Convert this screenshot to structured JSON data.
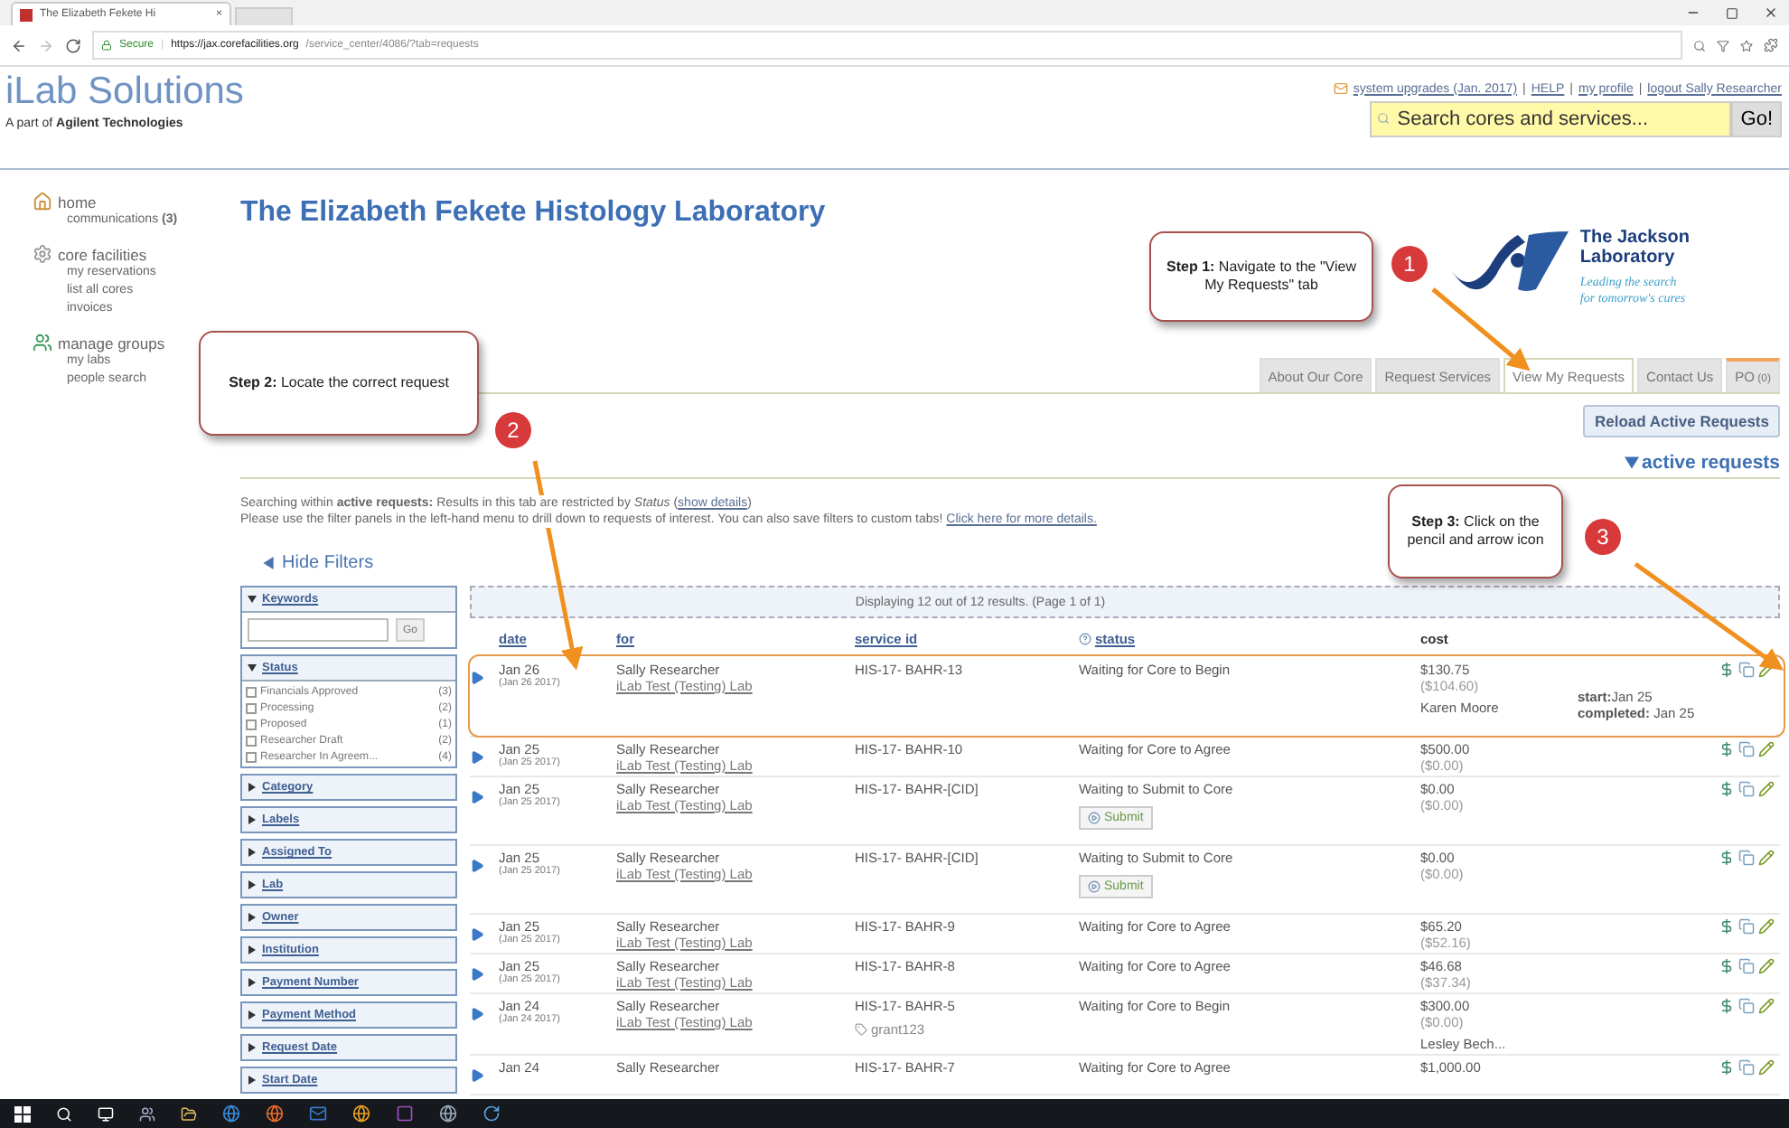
{
  "browser": {
    "tab_title": "The Elizabeth Fekete Hi",
    "tab_close": "×",
    "secure_label": "Secure",
    "url_host": "https://jax.corefacilities.org",
    "url_path": "/service_center/4086/?tab=requests"
  },
  "header": {
    "logo": "iLab Solutions",
    "tagline": "A part of **Agilent Technologies**"
  },
  "top_links": {
    "separator": "|",
    "links": [
      "system upgrades (Jan. 2017)",
      "HELP",
      "my profile",
      "logout Sally Researcher"
    ]
  },
  "search": {
    "placeholder": "Search cores and services...",
    "button": "Go!"
  },
  "nav": [
    {
      "label": "home",
      "kind": "home",
      "children": [
        {
          "label": "communications",
          "count": "(3)"
        }
      ]
    },
    {
      "label": "core facilities",
      "kind": "gear",
      "children": [
        {
          "label": "my reservations"
        },
        {
          "label": "list all cores"
        },
        {
          "label": "invoices"
        }
      ]
    },
    {
      "label": "manage groups",
      "kind": "people",
      "children": [
        {
          "label": "my labs"
        },
        {
          "label": "people search"
        }
      ]
    }
  ],
  "title": "The Elizabeth Fekete Histology Laboratory",
  "partner": {
    "name_lines": [
      "The Jackson",
      "Laboratory"
    ],
    "slogan_lines": [
      "Leading the search",
      "for tomorrow's cures"
    ]
  },
  "tabs": [
    {
      "label": "About Our Core",
      "selected": false
    },
    {
      "label": "Request Services",
      "selected": false
    },
    {
      "label": "View My Requests",
      "selected": true
    },
    {
      "label": "Contact Us",
      "selected": false
    },
    {
      "label": "PO",
      "count": "(0)",
      "selected": false
    }
  ],
  "reload_button": "Reload Active Requests",
  "section": {
    "label": "active requests",
    "expanded": true
  },
  "notice": [
    {
      "text": "Searching within **active requests:** Results in this tab are restricted by *Status* (",
      "link": "show details",
      "after": ")"
    },
    {
      "text": "Please use the filter panels in the left-hand menu to drill down to requests of interest. You can also save filters to custom tabs! ",
      "link": "Click here for more details."
    }
  ],
  "hide_filters": "Hide Filters",
  "filters": [
    {
      "title": "Keywords",
      "kind": "keywords",
      "expanded": true,
      "button": "Go"
    },
    {
      "title": "Status",
      "kind": "options",
      "expanded": true,
      "options": [
        {
          "label": "Financials Approved",
          "count": "(3)",
          "checked": false
        },
        {
          "label": "Processing",
          "count": "(2)",
          "checked": false
        },
        {
          "label": "Proposed",
          "count": "(1)",
          "checked": false
        },
        {
          "label": "Researcher Draft",
          "count": "(2)",
          "checked": false
        },
        {
          "label": "Researcher In Agreem...",
          "count": "(4)",
          "checked": false
        }
      ]
    },
    {
      "title": "Category",
      "expanded": false
    },
    {
      "title": "Labels",
      "expanded": false
    },
    {
      "title": "Assigned To",
      "expanded": false
    },
    {
      "title": "Lab",
      "expanded": false
    },
    {
      "title": "Owner",
      "expanded": false
    },
    {
      "title": "Institution",
      "expanded": false
    },
    {
      "title": "Payment Number",
      "expanded": false
    },
    {
      "title": "Payment Method",
      "expanded": false
    },
    {
      "title": "Request Date",
      "expanded": false
    },
    {
      "title": "Start Date",
      "expanded": false
    }
  ],
  "results": {
    "summary": "Displaying 12 out of 12 results. (Page 1 of 1)",
    "columns": [
      {
        "label": "date",
        "help": false,
        "sortable": true
      },
      {
        "label": "for",
        "help": false,
        "sortable": true
      },
      {
        "label": "service id",
        "help": false,
        "sortable": true
      },
      {
        "label": "status",
        "help": true,
        "sortable": true
      },
      {
        "label": "cost",
        "help": false,
        "sortable": false
      }
    ],
    "rows": [
      {
        "date": "Jan 26",
        "full_date": "(Jan 26 2017)",
        "person": "Sally Researcher",
        "lab": "iLab Test (Testing) Lab",
        "service_id": "HIS-17- BAHR-13",
        "status": "Waiting for Core to Begin",
        "cost": "$130.75",
        "subtotal": "($104.60)",
        "assignee": "Karen Moore",
        "start_label": "start:",
        "start": "Jan 25",
        "completed_label": "completed:",
        "completed": "Jan 25",
        "highlighted": true
      },
      {
        "date": "Jan 25",
        "full_date": "(Jan 25 2017)",
        "person": "Sally Researcher",
        "lab": "iLab Test (Testing) Lab",
        "service_id": "HIS-17- BAHR-10",
        "status": "Waiting for Core to Agree",
        "cost": "$500.00",
        "subtotal": "($0.00)",
        "highlighted": false
      },
      {
        "date": "Jan 25",
        "full_date": "(Jan 25 2017)",
        "person": "Sally Researcher",
        "lab": "iLab Test (Testing) Lab",
        "service_id": "HIS-17- BAHR-[CID]",
        "status": "Waiting to Submit to Core",
        "cost": "$0.00",
        "subtotal": "($0.00)",
        "action": "Submit",
        "highlighted": false
      },
      {
        "date": "Jan 25",
        "full_date": "(Jan 25 2017)",
        "person": "Sally Researcher",
        "lab": "iLab Test (Testing) Lab",
        "service_id": "HIS-17- BAHR-[CID]",
        "status": "Waiting to Submit to Core",
        "cost": "$0.00",
        "subtotal": "($0.00)",
        "action": "Submit",
        "highlighted": false
      },
      {
        "date": "Jan 25",
        "full_date": "(Jan 25 2017)",
        "person": "Sally Researcher",
        "lab": "iLab Test (Testing) Lab",
        "service_id": "HIS-17- BAHR-9",
        "status": "Waiting for Core to Agree",
        "cost": "$65.20",
        "subtotal": "($52.16)",
        "highlighted": false
      },
      {
        "date": "Jan 25",
        "full_date": "(Jan 25 2017)",
        "person": "Sally Researcher",
        "lab": "iLab Test (Testing) Lab",
        "service_id": "HIS-17- BAHR-8",
        "status": "Waiting for Core to Agree",
        "cost": "$46.68",
        "subtotal": "($37.34)",
        "highlighted": false
      },
      {
        "date": "Jan 24",
        "full_date": "(Jan 24 2017)",
        "person": "Sally Researcher",
        "lab": "iLab Test (Testing) Lab",
        "service_id": "HIS-17- BAHR-5",
        "grant": "grant123",
        "status": "Waiting for Core to Begin",
        "cost": "$300.00",
        "subtotal": "($0.00)",
        "assignee": "Lesley Bech...",
        "highlighted": false
      },
      {
        "date": "Jan 24",
        "person": "Sally Researcher",
        "service_id": "HIS-17- BAHR-7",
        "status": "Waiting for Core to Agree",
        "cost": "$1,000.00",
        "highlighted": false
      }
    ]
  },
  "callouts": [
    {
      "number": "1",
      "text": "**Step 1:** Navigate to the \"View My Requests\" tab"
    },
    {
      "number": "2",
      "text": "**Step 2:** Locate the correct request"
    },
    {
      "number": "3",
      "text": "**Step 3:** Click on the pencil and arrow icon"
    }
  ]
}
